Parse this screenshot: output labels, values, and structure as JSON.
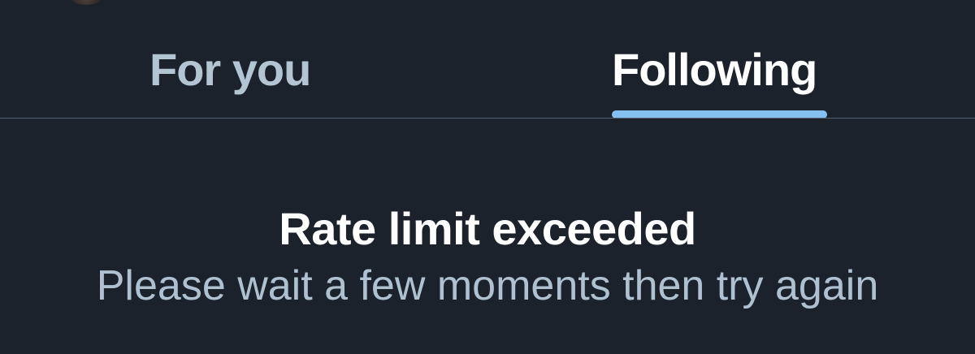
{
  "tabs": [
    {
      "label": "For you",
      "selected": false
    },
    {
      "label": "Following",
      "selected": true
    }
  ],
  "colors": {
    "background": "#1b222c",
    "active_tab_text": "#ffffff",
    "inactive_tab_text": "#b3c4d3",
    "tab_indicator": "#85c1f0",
    "divider": "#536170",
    "message_title": "#ffffff",
    "message_body": "#afc1d1"
  },
  "error": {
    "title": "Rate limit exceeded",
    "message": "Please wait a few moments then try again"
  }
}
